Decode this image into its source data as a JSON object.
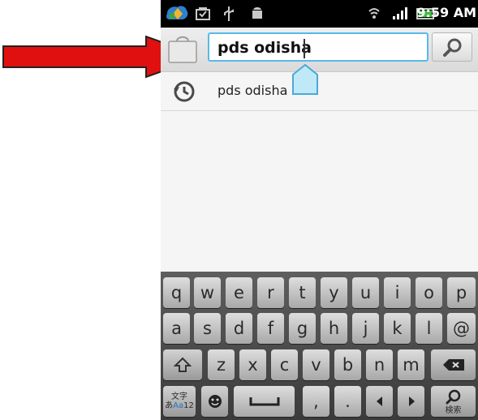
{
  "status_bar": {
    "time": "9:59 AM"
  },
  "search": {
    "query": "pds odisha"
  },
  "suggestions": [
    {
      "label": "pds odisha"
    }
  ],
  "keyboard": {
    "row1": [
      "q",
      "w",
      "e",
      "r",
      "t",
      "y",
      "u",
      "i",
      "o",
      "p"
    ],
    "row2": [
      "a",
      "s",
      "d",
      "f",
      "g",
      "h",
      "j",
      "k",
      "l",
      "@"
    ],
    "row3": [
      "z",
      "x",
      "c",
      "v",
      "b",
      "n",
      "m"
    ],
    "row4": {
      "lang_top": "文字",
      "lang_bottom_a": "あ",
      "lang_bottom_b": "Aa",
      "lang_bottom_c": "12",
      "comma": ",",
      "period": ".",
      "search_key_label": "検索"
    }
  },
  "colors": {
    "arrow": "#e01010",
    "search_border": "#59b9ea"
  }
}
